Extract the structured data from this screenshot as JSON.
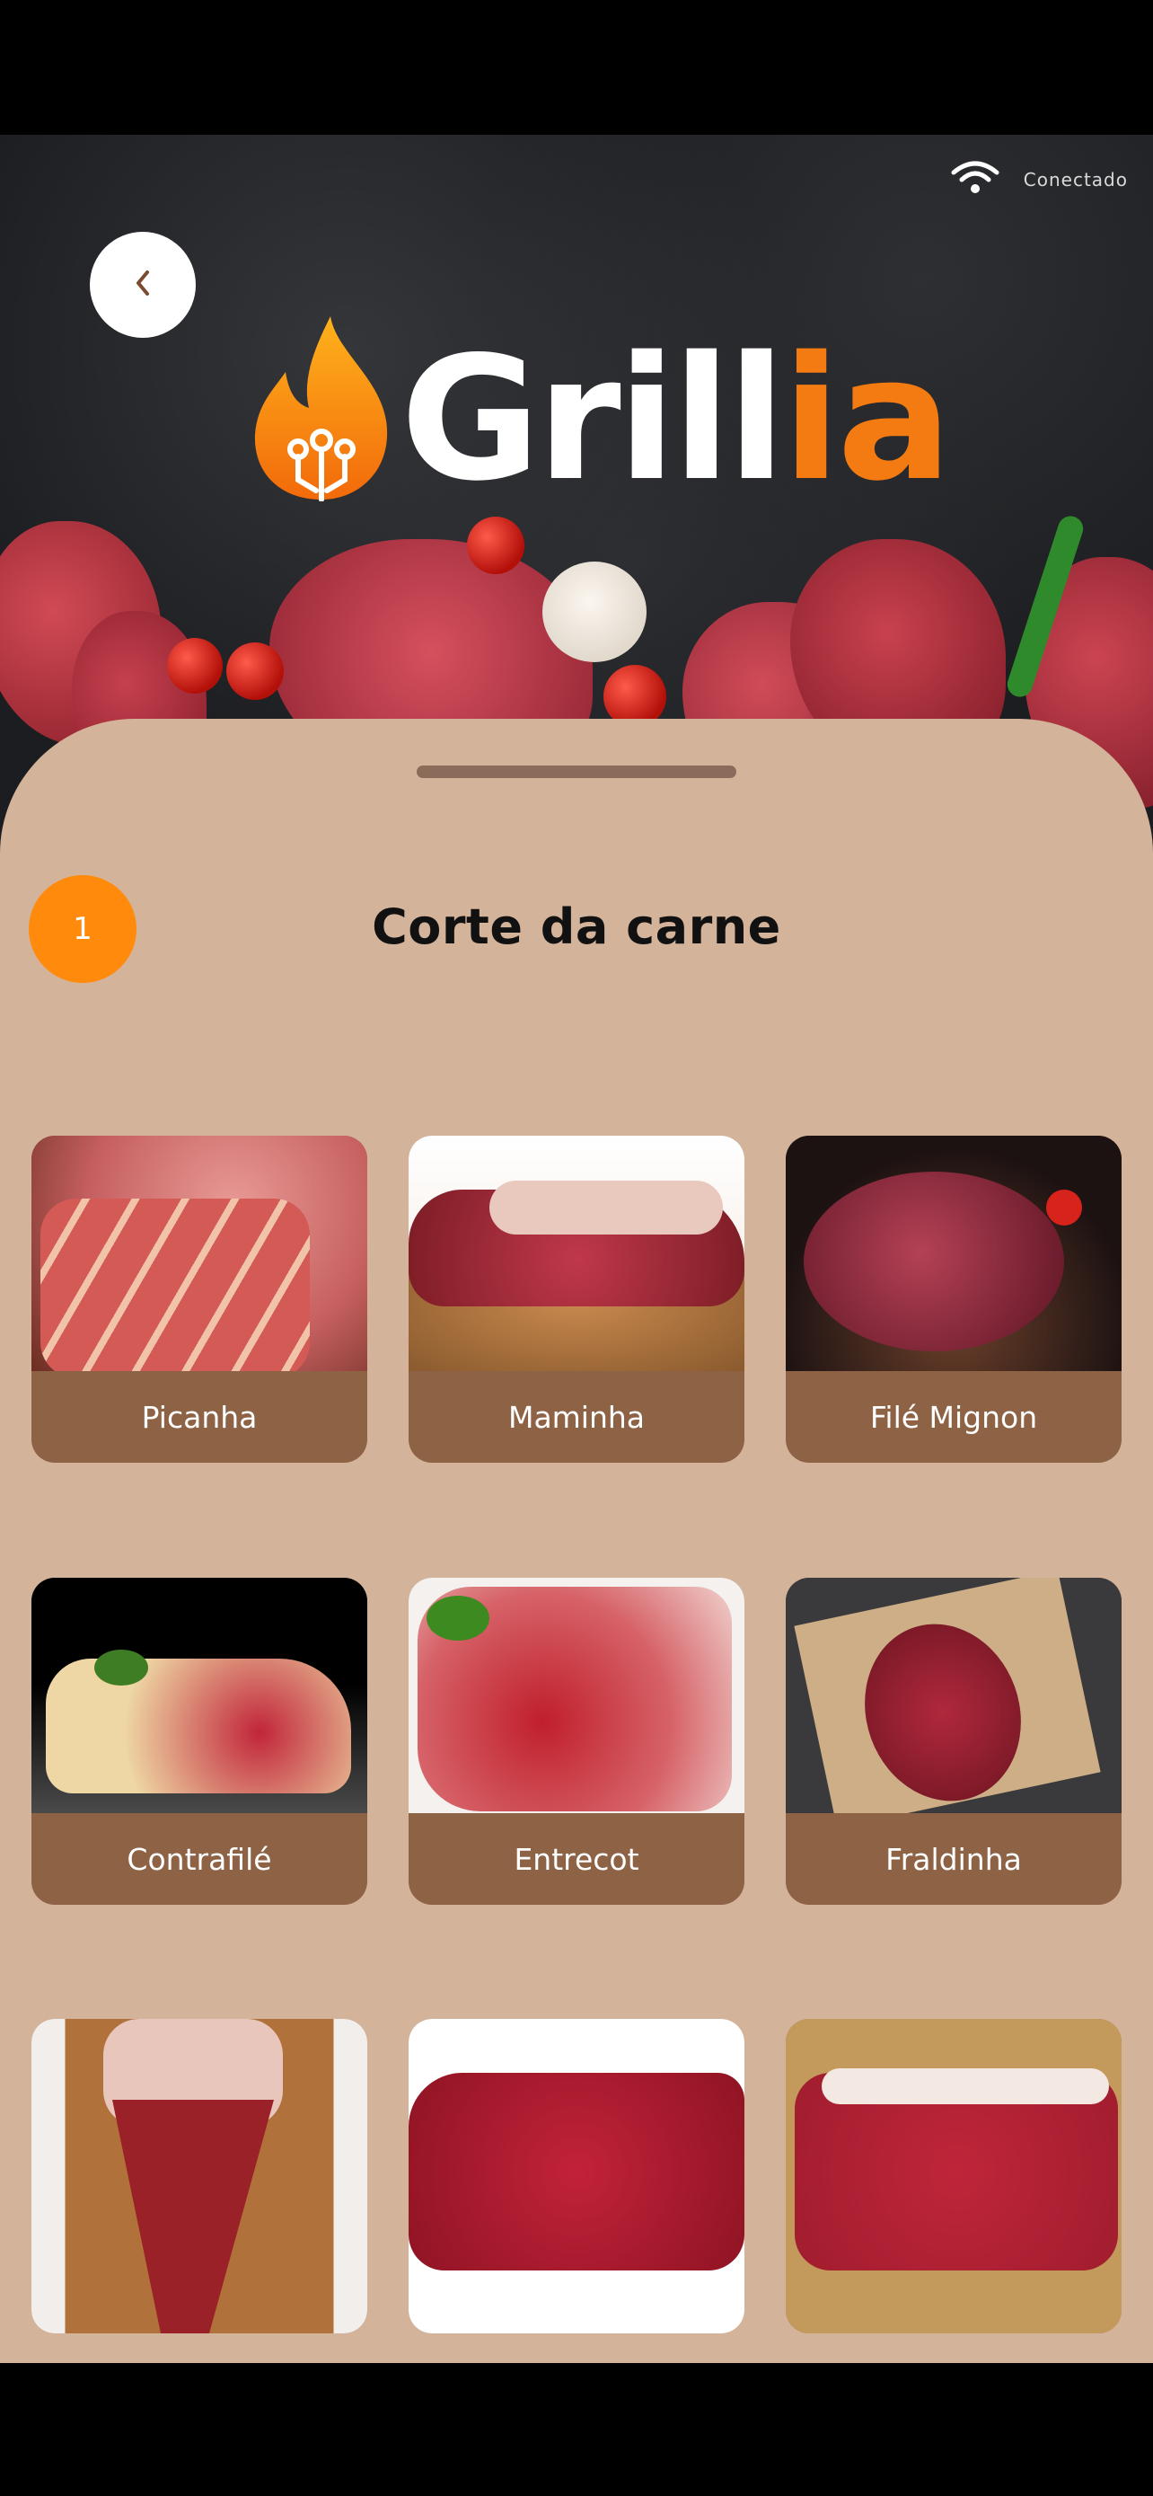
{
  "status": {
    "connection_text": "Conectado",
    "wifi_icon": "wifi-icon"
  },
  "header": {
    "back_icon": "chevron-left-icon",
    "logo_text_white": "Grill",
    "logo_text_orange": "ia",
    "brand_orange": "#f47a12"
  },
  "step": {
    "number": "1",
    "title": "Corte da carne",
    "badge_color": "#ff8a0c"
  },
  "cuts": [
    {
      "label": "Picanha"
    },
    {
      "label": "Maminha"
    },
    {
      "label": "Filé Mignon"
    },
    {
      "label": "Contrafilé"
    },
    {
      "label": "Entrecot"
    },
    {
      "label": "Fraldinha"
    },
    {
      "label": ""
    },
    {
      "label": ""
    },
    {
      "label": ""
    }
  ],
  "colors": {
    "sheet": "#d4b39b",
    "card_label": "#8d6245"
  }
}
